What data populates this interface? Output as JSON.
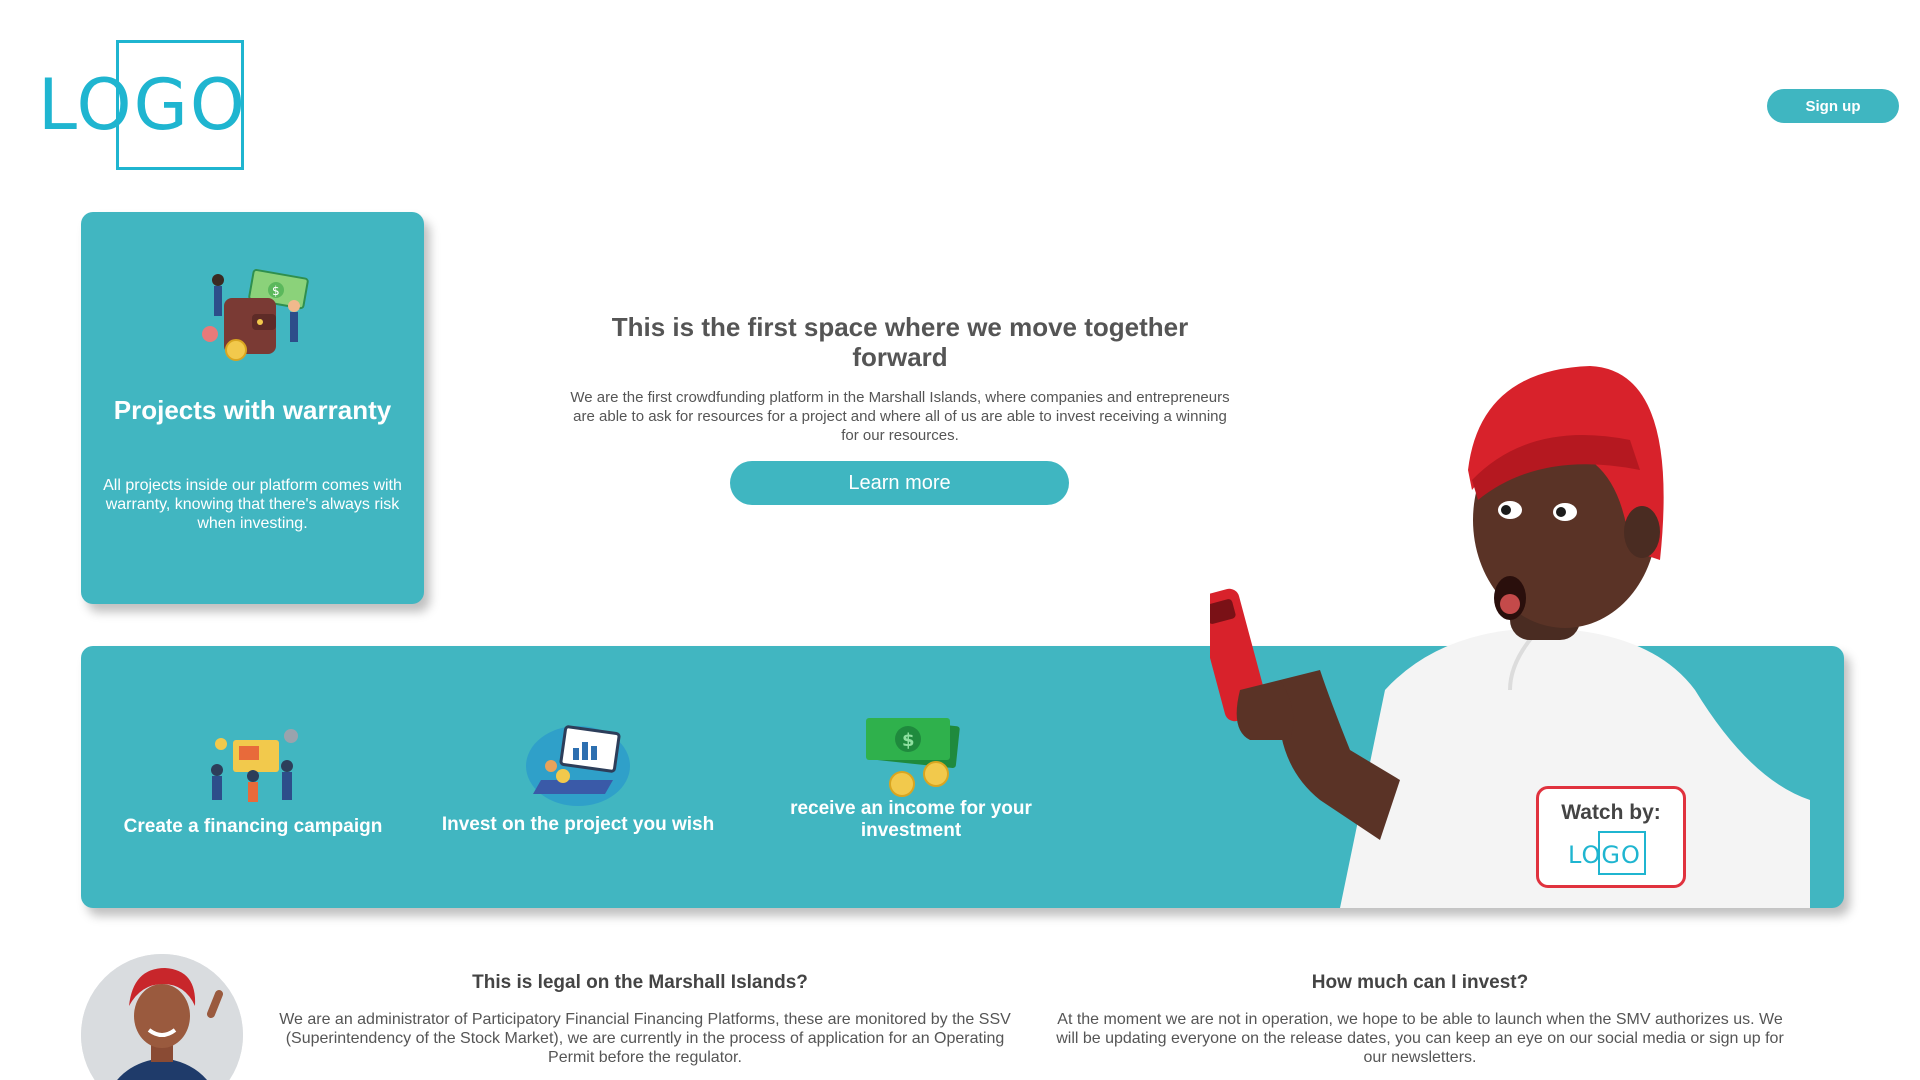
{
  "header": {
    "logo_text": "LOGO",
    "signup_label": "Sign up"
  },
  "warranty_card": {
    "title": "Projects with warranty",
    "text": "All projects inside our platform comes with warranty, knowing that there's always risk when investing."
  },
  "hero": {
    "title": "This is the first space where we move together forward",
    "text": "We are the first crowdfunding platform in the Marshall Islands, where companies and entrepreneurs are able to ask for resources for a project and where all of us are able to invest receiving a winning for our resources.",
    "button_label": "Learn more"
  },
  "steps": [
    {
      "label": "Create a financing campaign",
      "icon": "team-campaign-icon"
    },
    {
      "label": "Invest on the project you wish",
      "icon": "laptop-investment-icon"
    },
    {
      "label": "receive an income for your investment",
      "icon": "money-income-icon"
    }
  ],
  "watch": {
    "label": "Watch by:",
    "logo_text": "LOGO"
  },
  "faq": [
    {
      "title": "This is legal on the Marshall Islands?",
      "text": "We are an administrator of Participatory Financial Financing Platforms, these are monitored by the SSV (Superintendency of the Stock Market), we are currently in the process of application for an Operating Permit before the regulator."
    },
    {
      "title": "How much can I invest?",
      "text": "At the moment we are not in operation, we hope to be able to launch when the SMV authorizes us. We will be updating everyone on the release dates, you can keep an eye on our social media or sign up for our newsletters."
    }
  ],
  "colors": {
    "brand_teal": "#41b6c1",
    "logo_blue": "#1fb5d0",
    "accent_red": "#e0323e"
  }
}
